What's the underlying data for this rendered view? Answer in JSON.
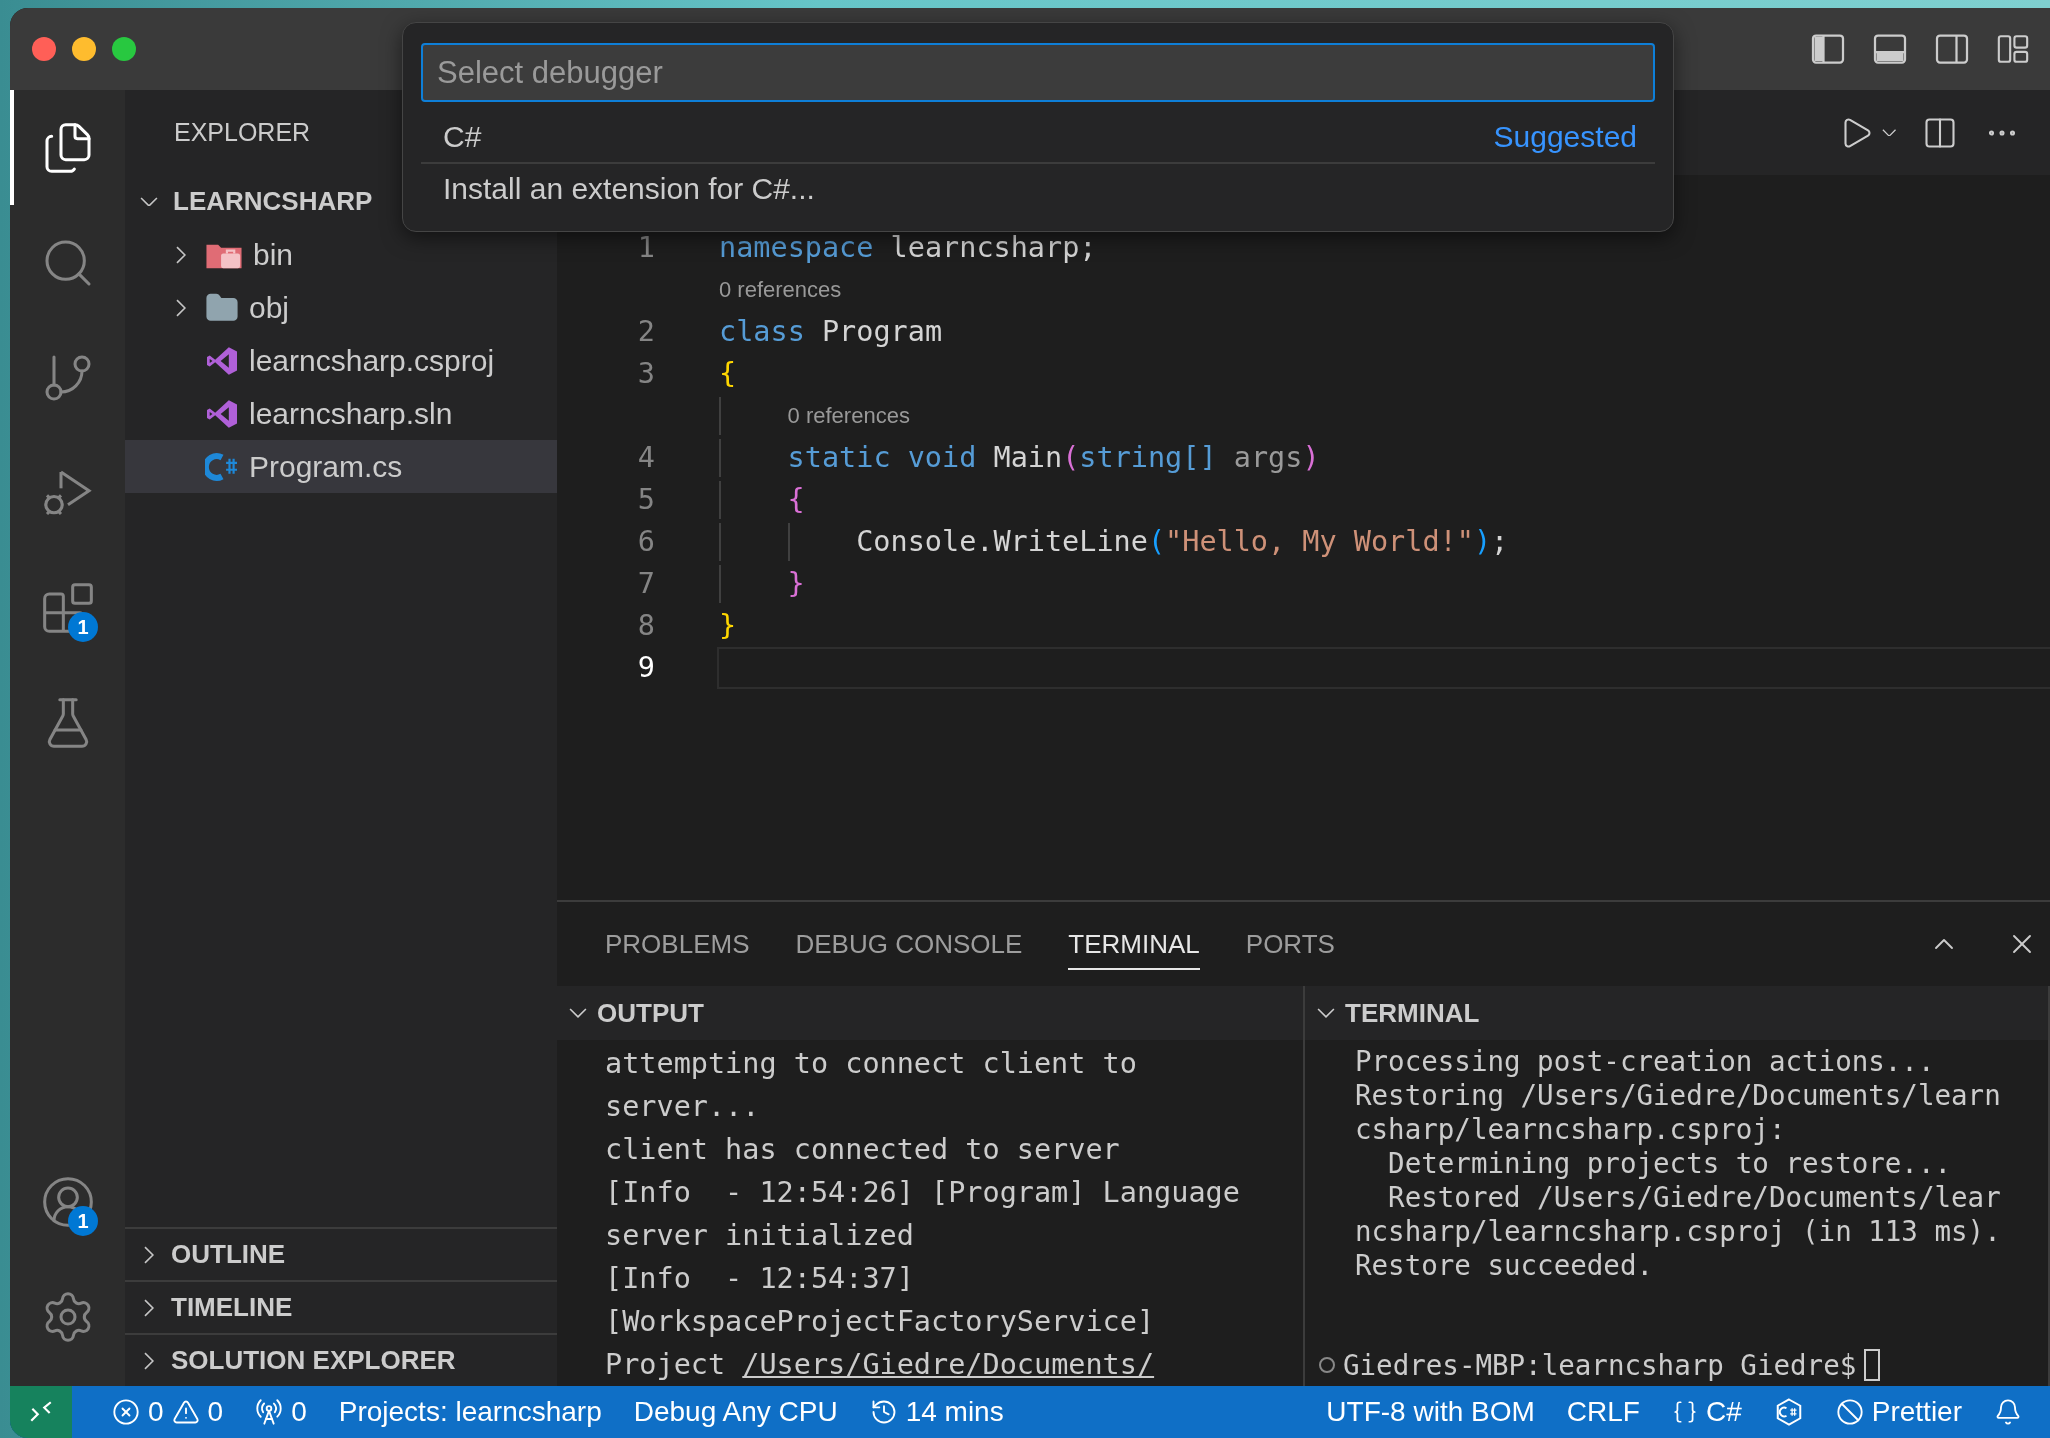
{
  "title_bar": {
    "layout_toggles": [
      {
        "kind": "primary-sidebar",
        "on": true
      },
      {
        "kind": "panel",
        "on": true
      },
      {
        "kind": "secondary-sidebar",
        "on": false
      }
    ]
  },
  "activity_bar": {
    "items": [
      {
        "kind": "explorer",
        "selected": true
      },
      {
        "kind": "search",
        "selected": false
      },
      {
        "kind": "source-control",
        "selected": false
      },
      {
        "kind": "run-debug",
        "selected": false
      },
      {
        "kind": "extensions",
        "selected": false,
        "badge": "1"
      },
      {
        "kind": "testing",
        "selected": false
      }
    ],
    "bottom": [
      {
        "kind": "accounts",
        "badge": "1"
      },
      {
        "kind": "settings"
      }
    ]
  },
  "sidebar": {
    "title": "EXPLORER",
    "tree": {
      "label": "LEARNCSHARP",
      "expanded": true,
      "children": [
        {
          "label": "bin",
          "kind": "bin-folder",
          "expanded": false,
          "selected": false
        },
        {
          "label": "obj",
          "kind": "folder",
          "expanded": false,
          "selected": false
        },
        {
          "label": "learncsharp.csproj",
          "kind": "vs-file",
          "selected": false
        },
        {
          "label": "learncsharp.sln",
          "kind": "vs-file",
          "selected": false
        },
        {
          "label": "Program.cs",
          "kind": "cs-file",
          "selected": true
        }
      ]
    },
    "sections": [
      {
        "label": "OUTLINE",
        "expanded": false
      },
      {
        "label": "TIMELINE",
        "expanded": false
      },
      {
        "label": "SOLUTION EXPLORER",
        "expanded": false
      }
    ]
  },
  "quick_pick": {
    "placeholder": "Select debugger",
    "items": [
      {
        "label": "C#",
        "detail": "Suggested"
      },
      {
        "label": "Install an extension for C#..."
      }
    ]
  },
  "editor": {
    "lines": [
      {
        "kind": "code",
        "number": "1",
        "current": false,
        "tokens": [
          {
            "text": "namespace",
            "kind": "keyword"
          },
          {
            "text": " learncsharp;",
            "kind": "plain"
          }
        ]
      },
      {
        "kind": "codelens",
        "text": "0 references"
      },
      {
        "kind": "code",
        "number": "2",
        "current": false,
        "tokens": [
          {
            "text": "class",
            "kind": "keyword"
          },
          {
            "text": " Program",
            "kind": "plain"
          }
        ]
      },
      {
        "kind": "code",
        "number": "3",
        "current": false,
        "tokens": [
          {
            "text": "{",
            "kind": "bracket1"
          }
        ]
      },
      {
        "kind": "codelens",
        "text": "    0 references"
      },
      {
        "kind": "code",
        "number": "4",
        "current": false,
        "tokens": [
          {
            "text": "    static",
            "kind": "keyword"
          },
          {
            "text": " void",
            "kind": "keyword"
          },
          {
            "text": " Main",
            "kind": "plain"
          },
          {
            "text": "(",
            "kind": "bracket2"
          },
          {
            "text": "string[]",
            "kind": "keyword"
          },
          {
            "text": " args",
            "kind": "param"
          },
          {
            "text": ")",
            "kind": "bracket2"
          }
        ]
      },
      {
        "kind": "code",
        "number": "5",
        "current": false,
        "tokens": [
          {
            "text": "    {",
            "kind": "bracket2"
          }
        ]
      },
      {
        "kind": "code",
        "number": "6",
        "current": false,
        "tokens": [
          {
            "text": "        Console.WriteLine",
            "kind": "plain"
          },
          {
            "text": "(",
            "kind": "bracket3"
          },
          {
            "text": "\"Hello, My World!\"",
            "kind": "string"
          },
          {
            "text": ")",
            "kind": "bracket3"
          },
          {
            "text": ";",
            "kind": "plain"
          }
        ]
      },
      {
        "kind": "code",
        "number": "7",
        "current": false,
        "tokens": [
          {
            "text": "    }",
            "kind": "bracket2"
          }
        ]
      },
      {
        "kind": "code",
        "number": "8",
        "current": false,
        "tokens": [
          {
            "text": "}",
            "kind": "bracket1"
          }
        ]
      },
      {
        "kind": "code",
        "number": "9",
        "current": true
      }
    ]
  },
  "panel": {
    "tabs": [
      {
        "label": "PROBLEMS",
        "selected": false
      },
      {
        "label": "DEBUG CONSOLE",
        "selected": false
      },
      {
        "label": "TERMINAL",
        "selected": true
      },
      {
        "label": "PORTS",
        "selected": false
      }
    ],
    "output": {
      "title": "OUTPUT",
      "expanded": true,
      "lines": [
        {
          "text": "attempting to connect client to"
        },
        {
          "text": "server..."
        },
        {
          "text": "client has connected to server"
        },
        {
          "text": "[Info  - 12:54:26] [Program] Language"
        },
        {
          "text": "server initialized"
        },
        {
          "text": "[Info  - 12:54:37]"
        },
        {
          "text": "[WorkspaceProjectFactoryService]"
        },
        {
          "text": "Project ",
          "link": "/Users/Giedre/Documents/"
        }
      ]
    },
    "terminal": {
      "title": "TERMINAL",
      "expanded": true,
      "lines": [
        "Processing post-creation actions...",
        "Restoring /Users/Giedre/Documents/learn",
        "csharp/learncsharp.csproj:",
        "  Determining projects to restore...",
        "  Restored /Users/Giedre/Documents/lear",
        "ncsharp/learncsharp.csproj (in 113 ms).",
        "Restore succeeded."
      ],
      "prompt": "Giedres-MBP:learncsharp Giedre$"
    }
  },
  "status_bar": {
    "left": [
      {
        "kind": "remote"
      },
      {
        "kind": "problems",
        "errors": "0",
        "warnings": "0"
      },
      {
        "kind": "ports",
        "text": "0"
      },
      {
        "kind": "text",
        "text": "Projects: learncsharp"
      },
      {
        "kind": "text",
        "text": "Debug Any CPU"
      },
      {
        "kind": "history",
        "text": "14 mins"
      }
    ],
    "right": [
      {
        "kind": "text",
        "text": "UTF-8 with BOM"
      },
      {
        "kind": "text",
        "text": "CRLF"
      },
      {
        "kind": "language",
        "text": "C#"
      },
      {
        "kind": "csharp"
      },
      {
        "kind": "prettier",
        "text": "Prettier"
      },
      {
        "kind": "bell"
      }
    ]
  }
}
